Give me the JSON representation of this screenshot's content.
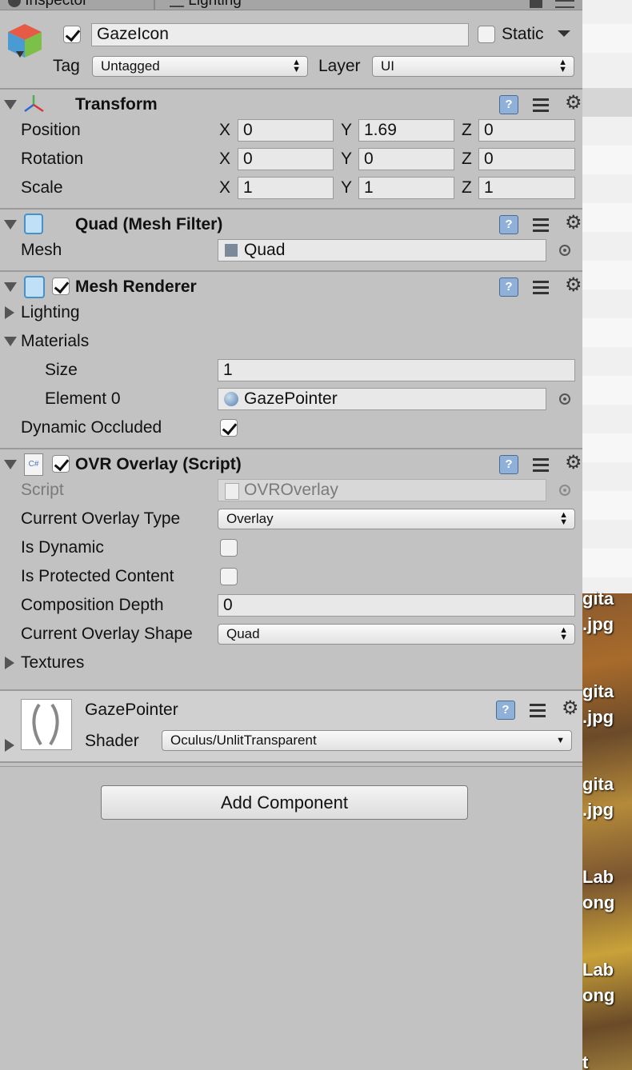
{
  "tabs": {
    "inspector": "Inspector",
    "lighting": "Lighting"
  },
  "object": {
    "name": "GazeIcon",
    "active": true,
    "static_label": "Static",
    "static": false,
    "tag_label": "Tag",
    "tag_value": "Untagged",
    "layer_label": "Layer",
    "layer_value": "UI"
  },
  "transform": {
    "title": "Transform",
    "rows": [
      {
        "label": "Position",
        "x": "0",
        "y": "1.69",
        "z": "0"
      },
      {
        "label": "Rotation",
        "x": "0",
        "y": "0",
        "z": "0"
      },
      {
        "label": "Scale",
        "x": "1",
        "y": "1",
        "z": "1"
      }
    ],
    "axes": {
      "x": "X",
      "y": "Y",
      "z": "Z"
    }
  },
  "mesh_filter": {
    "title": "Quad (Mesh Filter)",
    "mesh_label": "Mesh",
    "mesh_value": "Quad"
  },
  "mesh_renderer": {
    "title": "Mesh Renderer",
    "enabled": true,
    "lighting_label": "Lighting",
    "materials_label": "Materials",
    "size_label": "Size",
    "size_value": "1",
    "element0_label": "Element 0",
    "element0_value": "GazePointer",
    "dynamic_occluded_label": "Dynamic Occluded",
    "dynamic_occluded": true
  },
  "ovr_overlay": {
    "title": "OVR Overlay (Script)",
    "enabled": true,
    "script_label": "Script",
    "script_value": "OVROverlay",
    "overlay_type_label": "Current Overlay Type",
    "overlay_type_value": "Overlay",
    "is_dynamic_label": "Is Dynamic",
    "is_dynamic": false,
    "is_protected_label": "Is Protected Content",
    "is_protected": false,
    "composition_depth_label": "Composition Depth",
    "composition_depth_value": "0",
    "overlay_shape_label": "Current Overlay Shape",
    "overlay_shape_value": "Quad",
    "textures_label": "Textures"
  },
  "material": {
    "name": "GazePointer",
    "shader_label": "Shader",
    "shader_value": "Oculus/UnlitTransparent"
  },
  "add_component_label": "Add Component",
  "icons": {
    "help": "?",
    "csharp": "C#"
  },
  "desktop_labels": [
    "gita",
    ".jpg",
    "gita",
    ".jpg",
    "gita",
    ".jpg",
    "Lab",
    "ong",
    "Lab",
    "ong",
    "t"
  ]
}
